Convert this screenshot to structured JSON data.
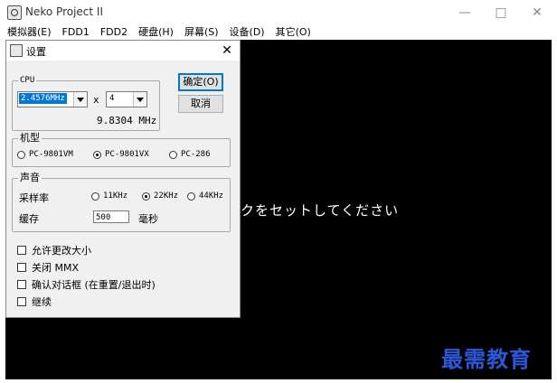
{
  "window": {
    "title": "Neko Project II",
    "controls": {
      "minimize": "—",
      "maximize": "□",
      "close": "✕"
    }
  },
  "menubar": [
    "模拟器(E)",
    "FDD1",
    "FDD2",
    "硬盘(H)",
    "屏幕(S)",
    "设备(D)",
    "其它(O)"
  ],
  "screen": {
    "message": "スクをセットしてください",
    "watermark": "最需教育"
  },
  "dialog": {
    "title": "设置",
    "close": "✕",
    "cpu": {
      "label": "CPU",
      "clock_value": "2.4576MHz",
      "multiplier_symbol": "x",
      "multiplier_value": "4",
      "result": "9.8304 MHz"
    },
    "buttons": {
      "ok": "确定(O)",
      "cancel": "取消"
    },
    "model": {
      "label": "机型",
      "options": [
        {
          "label": "PC-9801VM",
          "checked": false
        },
        {
          "label": "PC-9801VX",
          "checked": true
        },
        {
          "label": "PC-286",
          "checked": false
        }
      ]
    },
    "sound": {
      "label": "声音",
      "rate_label": "采样率",
      "rates": [
        {
          "label": "11KHz",
          "checked": false
        },
        {
          "label": "22KHz",
          "checked": true
        },
        {
          "label": "44KHz",
          "checked": false
        }
      ],
      "buffer_label": "缓存",
      "buffer_value": "500",
      "buffer_unit": "毫秒"
    },
    "checkboxes": [
      {
        "label": "允许更改大小",
        "checked": false
      },
      {
        "label": "关闭 MMX",
        "checked": false
      },
      {
        "label": "确认对话框 (在重置/退出时)",
        "checked": false
      },
      {
        "label": "继续",
        "checked": false
      }
    ]
  }
}
